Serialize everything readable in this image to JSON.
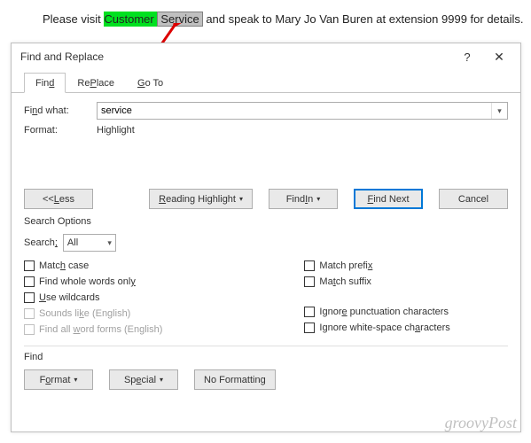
{
  "doc": {
    "prefix": "Please visit ",
    "highlight_word1": "Customer ",
    "highlight_word2": "Service",
    "suffix": " and speak to Mary Jo Van Buren at extension 9999 for details."
  },
  "dialog": {
    "title": "Find and Replace",
    "help": "?",
    "close": "✕",
    "tabs": {
      "find": "Find",
      "replace": "Replace",
      "goto": "Go To",
      "find_ul": "d",
      "replace_ul": "P",
      "goto_ul": "G"
    },
    "find_what_label": "Find what:",
    "find_what_value": "service",
    "format_label": "Format:",
    "format_value": "Highlight",
    "buttons": {
      "less": "<< Less",
      "reading_highlight": "Reading Highlight",
      "find_in": "Find In",
      "find_next": "Find Next",
      "cancel": "Cancel"
    },
    "search_options_label": "Search Options",
    "search_label": "Search:",
    "search_value": "All",
    "checks_left": {
      "match_case": "Match case",
      "whole_words": "Find whole words only",
      "wildcards": "Use wildcards",
      "sounds_like": "Sounds like (English)",
      "word_forms": "Find all word forms (English)"
    },
    "checks_right": {
      "match_prefix": "Match prefix",
      "match_suffix": "Match suffix",
      "ignore_punct": "Ignore punctuation characters",
      "ignore_white": "Ignore white-space characters"
    },
    "find_section_label": "Find",
    "bottom": {
      "format": "Format",
      "special": "Special",
      "no_formatting": "No Formatting"
    }
  },
  "watermark": "groovyPost"
}
